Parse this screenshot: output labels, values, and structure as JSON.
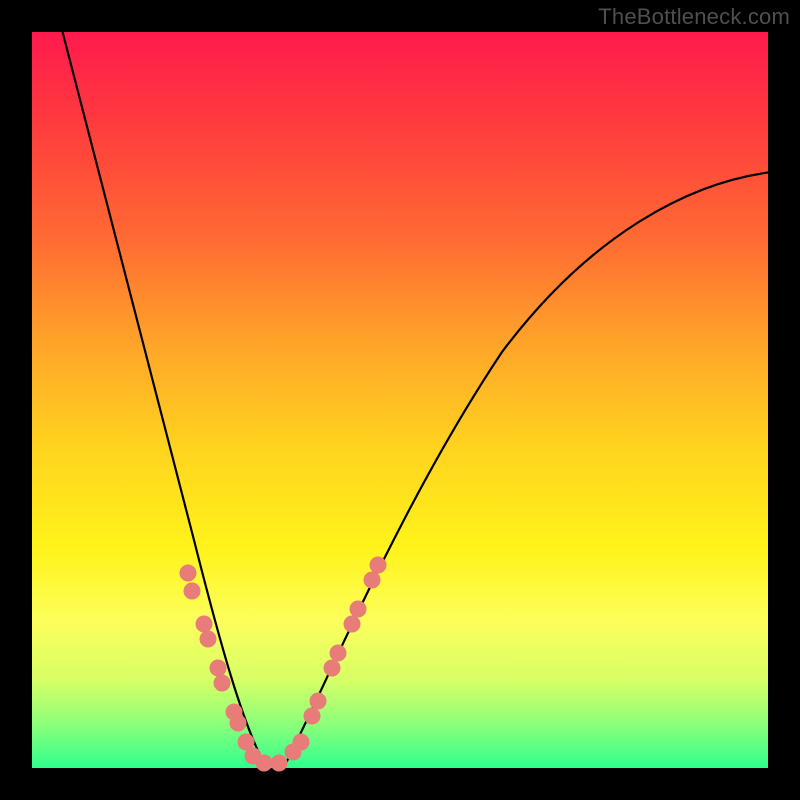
{
  "watermark": "TheBottleneck.com",
  "colors": {
    "frame": "#000000",
    "gradient_top": "#ff1a4d",
    "gradient_bottom": "#2fff8e",
    "curve": "#000000",
    "dot": "#e77c78"
  },
  "chart_data": {
    "type": "line",
    "title": "",
    "xlabel": "",
    "ylabel": "",
    "xlim": [
      0,
      100
    ],
    "ylim": [
      0,
      100
    ],
    "series": [
      {
        "name": "left-branch",
        "x": [
          4,
          8,
          12,
          16,
          20,
          24,
          26,
          28,
          30,
          31
        ],
        "y": [
          100,
          80,
          60,
          42,
          28,
          16,
          10,
          5,
          1,
          0
        ]
      },
      {
        "name": "right-branch",
        "x": [
          34,
          36,
          38,
          42,
          48,
          56,
          66,
          78,
          90,
          100
        ],
        "y": [
          0,
          2,
          6,
          14,
          26,
          40,
          54,
          66,
          74,
          80
        ]
      }
    ],
    "markers": [
      {
        "x": 21.0,
        "y": 26.0
      },
      {
        "x": 21.6,
        "y": 23.5
      },
      {
        "x": 23.2,
        "y": 19.0
      },
      {
        "x": 23.8,
        "y": 17.0
      },
      {
        "x": 25.2,
        "y": 13.0
      },
      {
        "x": 25.8,
        "y": 11.0
      },
      {
        "x": 27.4,
        "y": 7.0
      },
      {
        "x": 28.0,
        "y": 5.5
      },
      {
        "x": 29.0,
        "y": 3.0
      },
      {
        "x": 30.0,
        "y": 1.0
      },
      {
        "x": 31.5,
        "y": 0.0
      },
      {
        "x": 33.5,
        "y": 0.0
      },
      {
        "x": 35.5,
        "y": 1.5
      },
      {
        "x": 36.5,
        "y": 3.0
      },
      {
        "x": 38.0,
        "y": 6.5
      },
      {
        "x": 38.8,
        "y": 8.5
      },
      {
        "x": 40.8,
        "y": 13.0
      },
      {
        "x": 41.6,
        "y": 15.0
      },
      {
        "x": 43.5,
        "y": 19.0
      },
      {
        "x": 44.3,
        "y": 21.0
      },
      {
        "x": 46.2,
        "y": 25.0
      },
      {
        "x": 47.0,
        "y": 27.0
      }
    ]
  }
}
